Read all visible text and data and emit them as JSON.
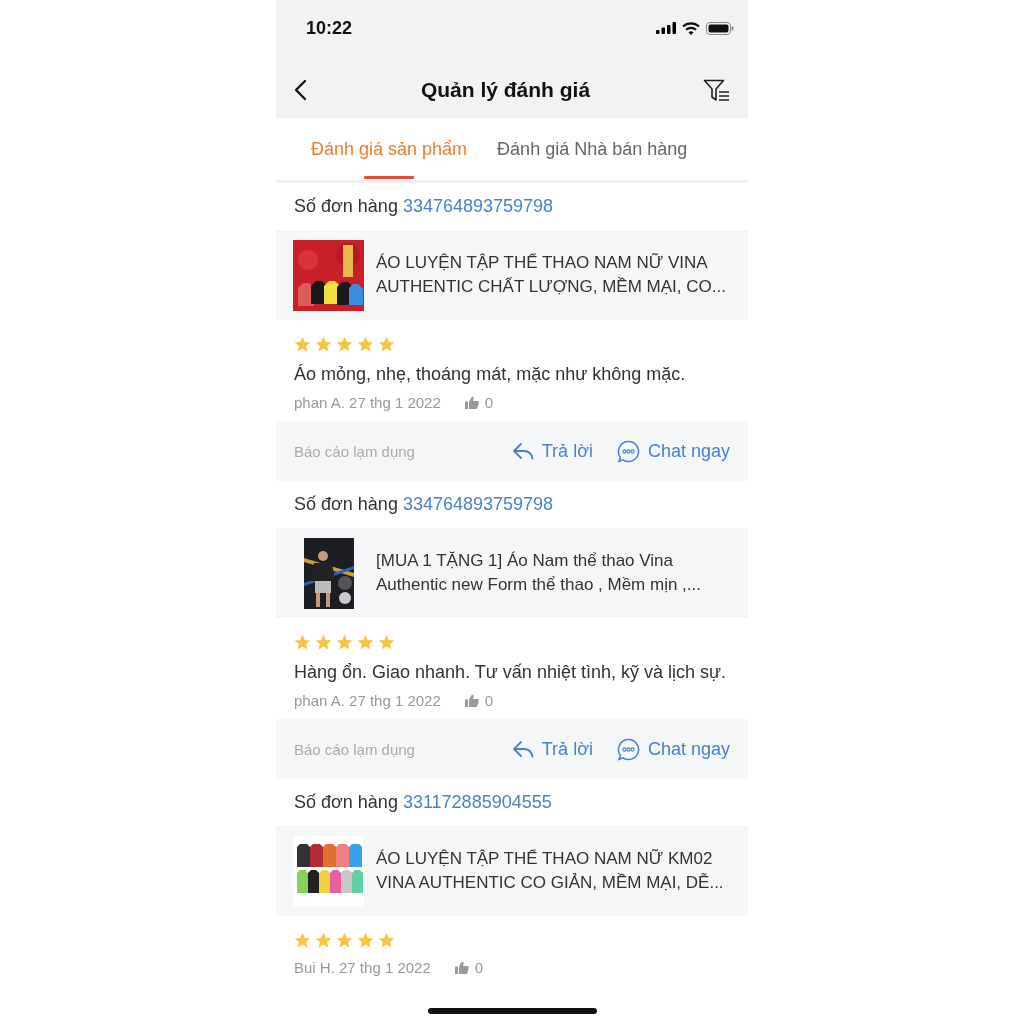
{
  "status_bar": {
    "time": "10:22"
  },
  "nav": {
    "title": "Quản lý đánh giá"
  },
  "tabs": [
    {
      "label": "Đánh giá sản phẩm",
      "selected": true
    },
    {
      "label": "Đánh giá Nhà bán hàng",
      "selected": false
    }
  ],
  "reviews": [
    {
      "order_label": "Số đơn hàng",
      "order_number": "334764893759798",
      "product": {
        "kind": "picture",
        "title": "ÁO LUYỆN TẬP THỂ THAO NAM NỮ VINA AUTHENTIC CHẤT LƯỢNG, MỀM MẠI, CO..."
      },
      "stars": 5,
      "comment": "Áo mỏng, nhẹ, thoáng mát, mặc như không mặc.",
      "author_date": "phan A. 27 thg 1 2022",
      "likes": "0",
      "actions": {
        "report": "Báo cáo lạm dụng",
        "reply": "Trả lời",
        "chat": "Chat ngay"
      }
    },
    {
      "order_label": "Số đơn hàng",
      "order_number": "334764893759798",
      "product": {
        "kind": "picture",
        "title": "[MUA 1 TẶNG 1] Áo Nam thể thao Vina Authentic new Form thể thao , Mềm mịn ,..."
      },
      "stars": 5,
      "comment": "Hàng ổn. Giao nhanh. Tư vấn nhiệt tình, kỹ và lịch sự.",
      "author_date": "phan A. 27 thg 1 2022",
      "likes": "0",
      "actions": {
        "report": "Báo cáo lạm dụng",
        "reply": "Trả lời",
        "chat": "Chat ngay"
      }
    },
    {
      "order_label": "Số đơn hàng",
      "order_number": "331172885904555",
      "product": {
        "kind": "picture",
        "title": "ÁO LUYỆN TẬP THỂ THAO NAM NỮ KM02 VINA AUTHENTIC CO GIẢN, MỀM MẠI, DỄ..."
      },
      "stars": 5,
      "author_date": "Bui H. 27 thg 1 2022",
      "likes": "0"
    }
  ]
}
